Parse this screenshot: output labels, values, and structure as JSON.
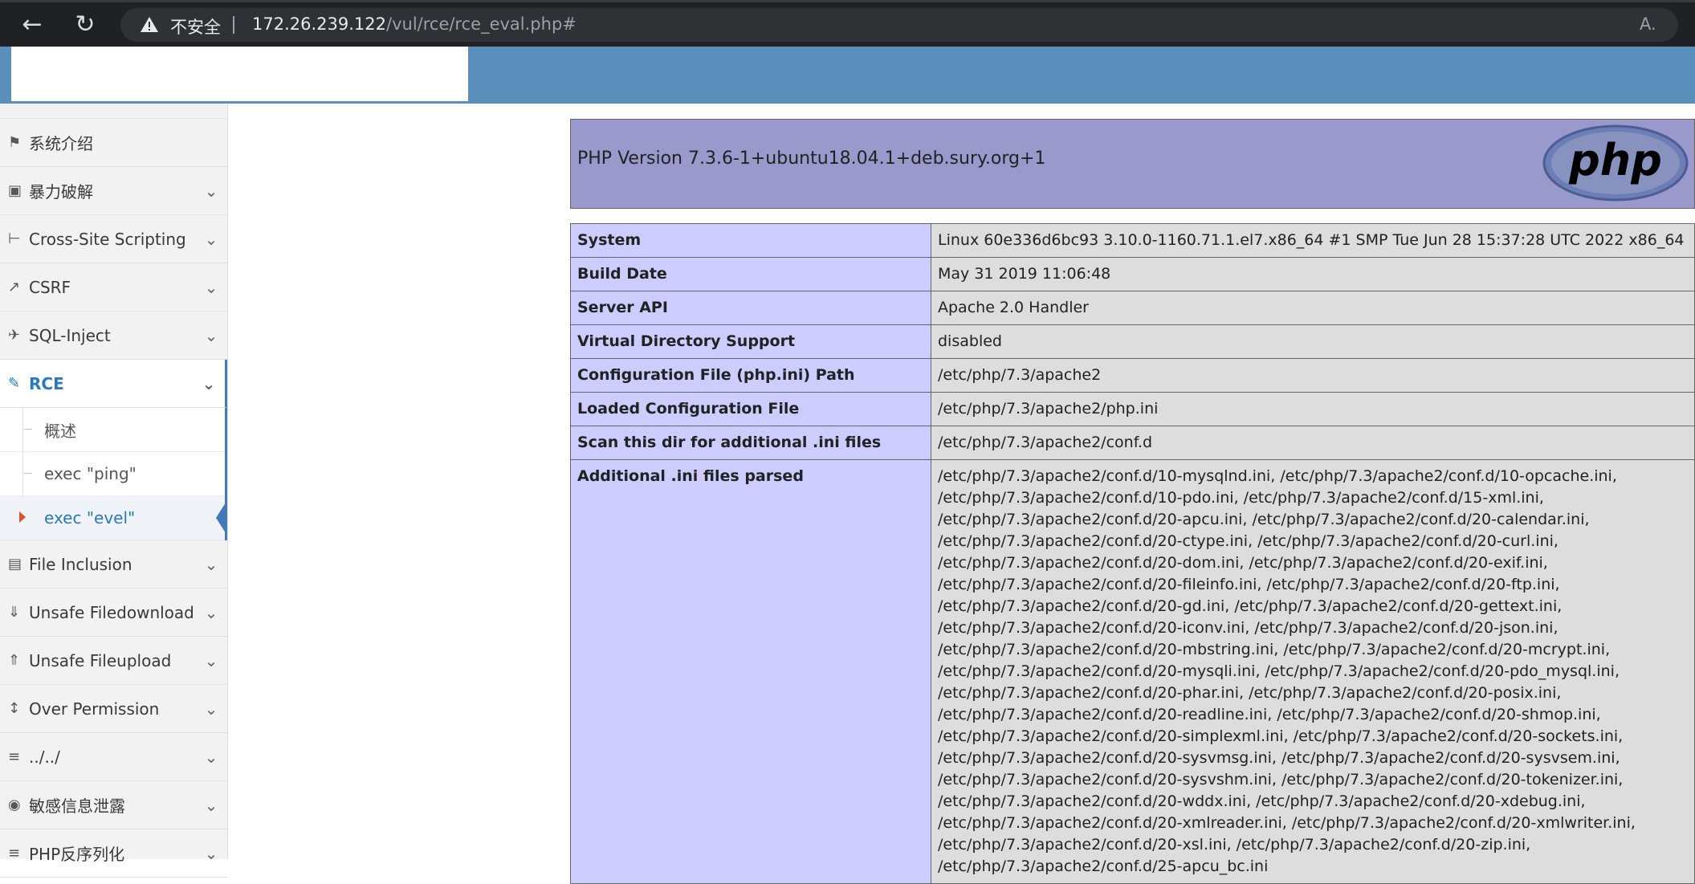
{
  "browser": {
    "insecure_label": "不安全",
    "url_host": "172.26.239.122",
    "url_path": "/vul/rce/rce_eval.php#"
  },
  "sidebar": {
    "items": [
      {
        "icon": "tag-icon",
        "label": "系统介绍",
        "expandable": false
      },
      {
        "icon": "lock-icon",
        "label": "暴力破解",
        "expandable": true
      },
      {
        "icon": "list-tree-icon",
        "label": "Cross-Site Scripting",
        "expandable": true
      },
      {
        "icon": "external-link-icon",
        "label": "CSRF",
        "expandable": true
      },
      {
        "icon": "plane-icon",
        "label": "SQL-Inject",
        "expandable": true
      },
      {
        "icon": "pencil-icon",
        "label": "RCE",
        "expandable": true,
        "active": true
      },
      {
        "icon": "file-icon",
        "label": "File Inclusion",
        "expandable": true
      },
      {
        "icon": "download-circle-icon",
        "label": "Unsafe Filedownload",
        "expandable": true
      },
      {
        "icon": "upload-circle-icon",
        "label": "Unsafe Fileupload",
        "expandable": true
      },
      {
        "icon": "text-height-icon",
        "label": "Over Permission",
        "expandable": true
      },
      {
        "icon": "align-left-icon",
        "label": "../../",
        "expandable": true
      },
      {
        "icon": "camera-icon",
        "label": "敏感信息泄露",
        "expandable": true
      },
      {
        "icon": "align-left-icon",
        "label": "PHP反序列化",
        "expandable": true
      }
    ],
    "rce_subitems": [
      {
        "label": "概述"
      },
      {
        "label": "exec \"ping\""
      },
      {
        "label": "exec \"evel\"",
        "current": true
      }
    ]
  },
  "phpinfo": {
    "version": "PHP Version 7.3.6-1+ubuntu18.04.1+deb.sury.org+1",
    "logo_text": "php",
    "rows": [
      {
        "key": "System",
        "value": "Linux 60e336d6bc93 3.10.0-1160.71.1.el7.x86_64 #1 SMP Tue Jun 28 15:37:28 UTC 2022 x86_64"
      },
      {
        "key": "Build Date",
        "value": "May 31 2019 11:06:48"
      },
      {
        "key": "Server API",
        "value": "Apache 2.0 Handler"
      },
      {
        "key": "Virtual Directory Support",
        "value": "disabled"
      },
      {
        "key": "Configuration File (php.ini) Path",
        "value": "/etc/php/7.3/apache2"
      },
      {
        "key": "Loaded Configuration File",
        "value": "/etc/php/7.3/apache2/php.ini"
      },
      {
        "key": "Scan this dir for additional .ini files",
        "value": "/etc/php/7.3/apache2/conf.d"
      }
    ],
    "additional_key": "Additional .ini files parsed",
    "additional_lines": [
      "/etc/php/7.3/apache2/conf.d/10-mysqlnd.ini, /etc/php/7.3/apache2/conf.d/10-opcache.ini,",
      "/etc/php/7.3/apache2/conf.d/10-pdo.ini, /etc/php/7.3/apache2/conf.d/15-xml.ini,",
      "/etc/php/7.3/apache2/conf.d/20-apcu.ini, /etc/php/7.3/apache2/conf.d/20-calendar.ini,",
      "/etc/php/7.3/apache2/conf.d/20-ctype.ini, /etc/php/7.3/apache2/conf.d/20-curl.ini,",
      "/etc/php/7.3/apache2/conf.d/20-dom.ini, /etc/php/7.3/apache2/conf.d/20-exif.ini,",
      "/etc/php/7.3/apache2/conf.d/20-fileinfo.ini, /etc/php/7.3/apache2/conf.d/20-ftp.ini,",
      "/etc/php/7.3/apache2/conf.d/20-gd.ini, /etc/php/7.3/apache2/conf.d/20-gettext.ini,",
      "/etc/php/7.3/apache2/conf.d/20-iconv.ini, /etc/php/7.3/apache2/conf.d/20-json.ini,",
      "/etc/php/7.3/apache2/conf.d/20-mbstring.ini, /etc/php/7.3/apache2/conf.d/20-mcrypt.ini,",
      "/etc/php/7.3/apache2/conf.d/20-mysqli.ini, /etc/php/7.3/apache2/conf.d/20-pdo_mysql.ini,",
      "/etc/php/7.3/apache2/conf.d/20-phar.ini, /etc/php/7.3/apache2/conf.d/20-posix.ini,",
      "/etc/php/7.3/apache2/conf.d/20-readline.ini, /etc/php/7.3/apache2/conf.d/20-shmop.ini,",
      "/etc/php/7.3/apache2/conf.d/20-simplexml.ini, /etc/php/7.3/apache2/conf.d/20-sockets.ini,",
      "/etc/php/7.3/apache2/conf.d/20-sysvmsg.ini, /etc/php/7.3/apache2/conf.d/20-sysvsem.ini,",
      "/etc/php/7.3/apache2/conf.d/20-sysvshm.ini, /etc/php/7.3/apache2/conf.d/20-tokenizer.ini,",
      "/etc/php/7.3/apache2/conf.d/20-wddx.ini, /etc/php/7.3/apache2/conf.d/20-xdebug.ini,",
      "/etc/php/7.3/apache2/conf.d/20-xmlreader.ini, /etc/php/7.3/apache2/conf.d/20-xmlwriter.ini,",
      "/etc/php/7.3/apache2/conf.d/20-xsl.ini, /etc/php/7.3/apache2/conf.d/20-zip.ini,",
      "/etc/php/7.3/apache2/conf.d/25-apcu_bc.ini"
    ]
  },
  "colors": {
    "header_blue": "#5a8fbb",
    "active_blue": "#2a78bd",
    "php_header": "#9999cc",
    "php_key": "#ccccff",
    "php_value": "#dddddd"
  }
}
